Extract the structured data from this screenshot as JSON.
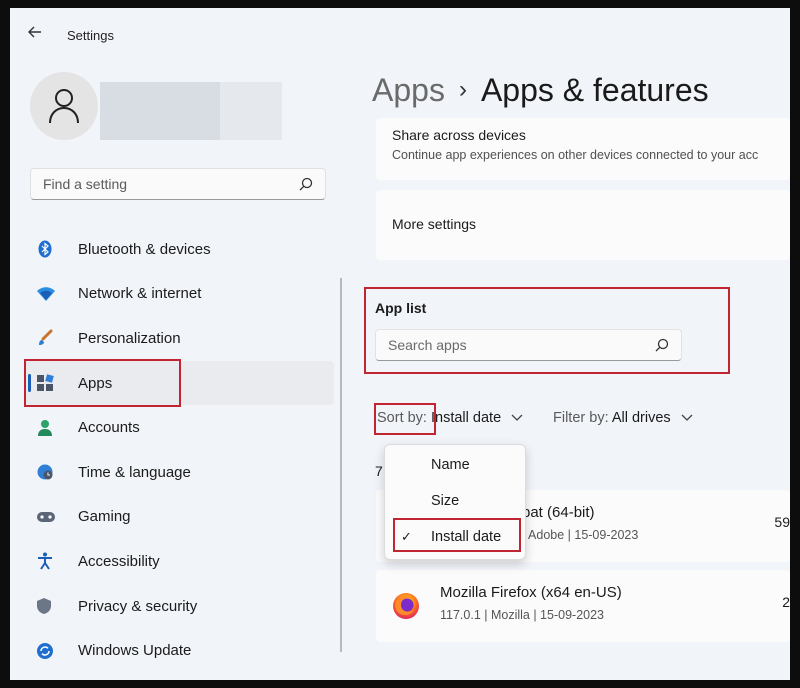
{
  "window": {
    "title": "Settings"
  },
  "search": {
    "placeholder": "Find a setting"
  },
  "sidebar": {
    "items": [
      {
        "label": "Bluetooth & devices"
      },
      {
        "label": "Network & internet"
      },
      {
        "label": "Personalization"
      },
      {
        "label": "Apps"
      },
      {
        "label": "Accounts"
      },
      {
        "label": "Time & language"
      },
      {
        "label": "Gaming"
      },
      {
        "label": "Accessibility"
      },
      {
        "label": "Privacy & security"
      },
      {
        "label": "Windows Update"
      }
    ],
    "active": "Apps"
  },
  "breadcrumb": {
    "parent": "Apps",
    "separator": "›",
    "current": "Apps & features"
  },
  "share_card": {
    "title": "Share across devices",
    "subtitle": "Continue app experiences on other devices connected to your acc"
  },
  "more_settings": {
    "title": "More settings"
  },
  "app_list": {
    "label": "App list",
    "search_placeholder": "Search apps",
    "sort_label": "Sort by:",
    "sort_value": "Install date",
    "filter_label": "Filter by:",
    "filter_value": "All drives",
    "count_fragment": "7"
  },
  "sort_menu": {
    "options": [
      "Name",
      "Size",
      "Install date"
    ],
    "selected": "Install date"
  },
  "apps": [
    {
      "name_fragment": "bat (64-bit)",
      "meta_fragment": "| Adobe | 15-09-2023",
      "size_fragment": "59"
    },
    {
      "name": "Mozilla Firefox (x64 en-US)",
      "meta": "117.0.1 | Mozilla | 15-09-2023",
      "size_fragment": "2"
    }
  ],
  "colors": {
    "accent": "#1c5fb8",
    "highlight_box": "#c22532",
    "window_bg": "#f1f4f9",
    "card_bg": "#fbfbfb"
  }
}
